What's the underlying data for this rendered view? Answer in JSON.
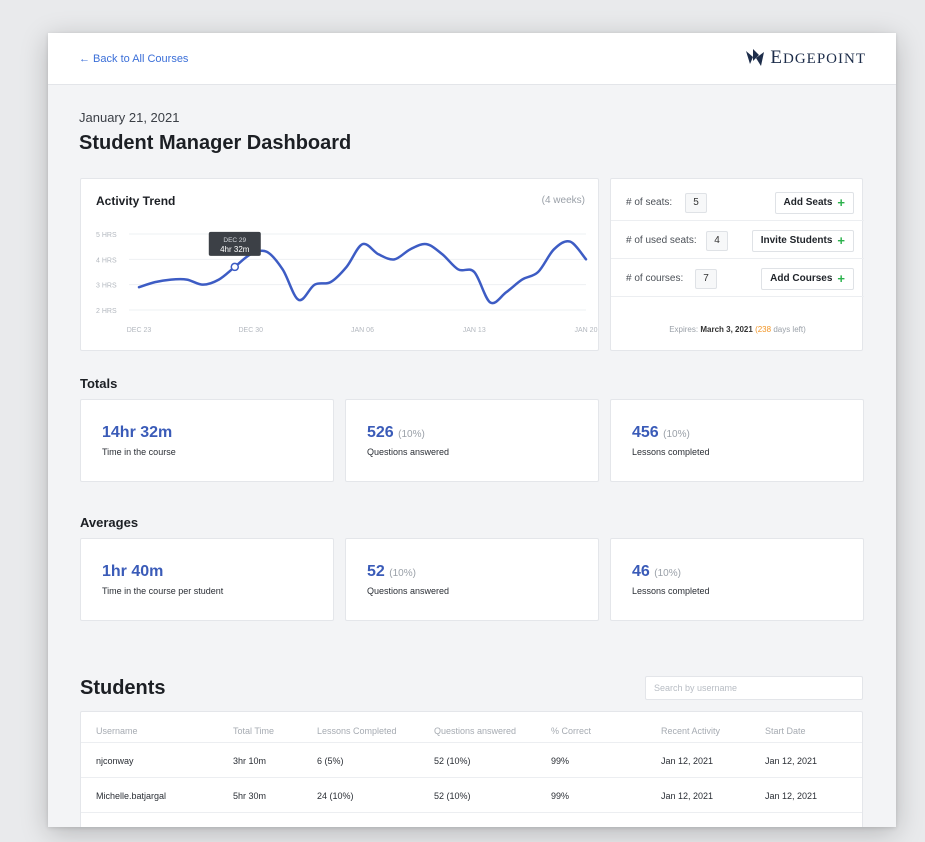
{
  "header": {
    "back_label": "← Back to All Courses",
    "logo_text_initial": "E",
    "logo_text_rest": "DGEPOINT",
    "logo_text_initial2": "P",
    "logo_text_rest2": "OINT"
  },
  "page": {
    "date": "January 21, 2021",
    "title": "Student Manager Dashboard"
  },
  "activity": {
    "title": "Activity Trend",
    "period": "(4 weeks)",
    "tooltip_date": "DEC 29",
    "tooltip_value": "4hr 32m",
    "y_ticks": [
      "5 HRS",
      "4 HRS",
      "3 HRS",
      "2 HRS"
    ],
    "x_ticks": [
      "DEC 23",
      "DEC 30",
      "JAN 06",
      "JAN 13",
      "JAN 20"
    ]
  },
  "chart_data": {
    "type": "line",
    "title": "Activity Trend",
    "x": [
      "Dec 23",
      "Dec 24",
      "Dec 25",
      "Dec 26",
      "Dec 27",
      "Dec 28",
      "Dec 29",
      "Dec 30",
      "Dec 31",
      "Jan 01",
      "Jan 02",
      "Jan 03",
      "Jan 04",
      "Jan 05",
      "Jan 06",
      "Jan 07",
      "Jan 08",
      "Jan 09",
      "Jan 10",
      "Jan 11",
      "Jan 12",
      "Jan 13",
      "Jan 14",
      "Jan 15",
      "Jan 16",
      "Jan 17",
      "Jan 18",
      "Jan 19",
      "Jan 20"
    ],
    "values": [
      2.9,
      3.1,
      3.2,
      3.2,
      3.0,
      3.2,
      3.7,
      4.2,
      4.3,
      3.6,
      2.4,
      3.0,
      3.1,
      3.7,
      4.6,
      4.2,
      4.0,
      4.4,
      4.6,
      4.2,
      3.6,
      3.5,
      2.3,
      2.7,
      3.2,
      3.5,
      4.4,
      4.7,
      4.0
    ],
    "ylim": [
      2,
      5
    ],
    "ylabel": "",
    "xlabel": "",
    "highlight": {
      "x": "Dec 29",
      "label": "4hr 32m"
    }
  },
  "seats": {
    "rows": [
      {
        "label": "# of seats:",
        "count": "5",
        "button": "Add Seats"
      },
      {
        "label": "# of used seats:",
        "count": "4",
        "button": "Invite Students"
      },
      {
        "label": "# of courses:",
        "count": "7",
        "button": "Add Courses"
      }
    ],
    "expires_prefix": "Expires:",
    "expires_date": "March 3, 2021",
    "days_left": "(238",
    "days_suffix": "days left)"
  },
  "totals": {
    "label": "Totals",
    "cards": [
      {
        "value": "14hr 32m",
        "pct": "",
        "label": "Time in the course"
      },
      {
        "value": "526",
        "pct": "(10%)",
        "label": "Questions answered"
      },
      {
        "value": "456",
        "pct": "(10%)",
        "label": "Lessons completed"
      }
    ]
  },
  "averages": {
    "label": "Averages",
    "cards": [
      {
        "value": "1hr 40m",
        "pct": "",
        "label": "Time in the course per student"
      },
      {
        "value": "52",
        "pct": "(10%)",
        "label": "Questions answered"
      },
      {
        "value": "46",
        "pct": "(10%)",
        "label": "Lessons completed"
      }
    ]
  },
  "students": {
    "title": "Students",
    "search_placeholder": "Search by username",
    "columns": [
      "Username",
      "Total Time",
      "Lessons Completed",
      "Questions answered",
      "% Correct",
      "Recent Activity",
      "Start Date"
    ],
    "rows": [
      [
        "njconway",
        "3hr 10m",
        "6 (5%)",
        "52 (10%)",
        "99%",
        "Jan 12, 2021",
        "Jan 12, 2021"
      ],
      [
        "Michelle.batjargal",
        "5hr 30m",
        "24 (10%)",
        "52 (10%)",
        "99%",
        "Jan 12, 2021",
        "Jan 12, 2021"
      ]
    ]
  },
  "colors": {
    "accent": "#3a5bb8",
    "line": "#3d5cc4",
    "plus": "#2bb24c",
    "days_left": "#f29423"
  }
}
